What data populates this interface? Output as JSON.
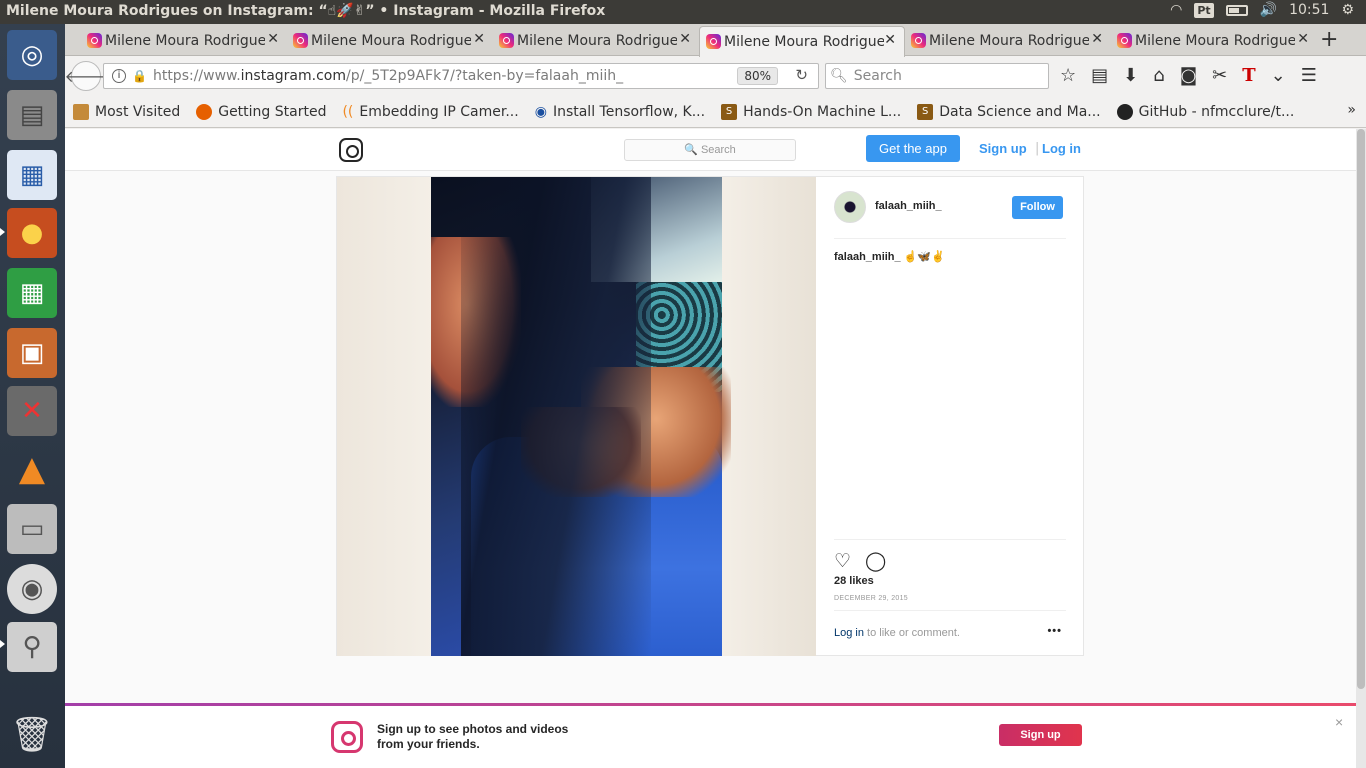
{
  "os": {
    "window_title": "Milene Moura Rodrigues on Instagram: “☝🚀✌” • Instagram - Mozilla Firefox",
    "keyboard_layout": "Pt",
    "clock": "10:51"
  },
  "browser": {
    "tabs": [
      {
        "label": "Milene Moura Rodrigues"
      },
      {
        "label": "Milene Moura Rodrigues"
      },
      {
        "label": "Milene Moura Rodrigues"
      },
      {
        "label": "Milene Moura Rodrigues"
      },
      {
        "label": "Milene Moura Rodrigues"
      },
      {
        "label": "Milene Moura Rodrigues"
      }
    ],
    "active_tab": 3,
    "url_host_prefix": "https://www.",
    "url_host": "instagram.com",
    "url_path": "/p/_5T2p9AFk7/?taken-by=falaah_miih_",
    "zoom": "80%",
    "search_placeholder": "Search",
    "bookmarks": [
      {
        "label": "Most Visited",
        "color": "#c48a3a"
      },
      {
        "label": "Getting Started",
        "color": "#e66000"
      },
      {
        "label": "Embedding IP Camer...",
        "color": "#f08a24"
      },
      {
        "label": "Install Tensorflow, K...",
        "color": "#1a4fa0"
      },
      {
        "label": "Hands-On Machine L...",
        "color": "#8a5a14"
      },
      {
        "label": "Data Science and Ma...",
        "color": "#8a5a14"
      },
      {
        "label": "GitHub - nfmcclure/t...",
        "color": "#222222"
      }
    ]
  },
  "instagram": {
    "search_placeholder": "🔍 Search",
    "get_app": "Get the app",
    "sign_up": "Sign up",
    "separator": "|",
    "log_in": "Log in",
    "post": {
      "username": "falaah_miih_",
      "follow": "Follow",
      "caption_user": "falaah_miih_",
      "caption_text": "☝🦋✌",
      "likes": "28 likes",
      "date": "DECEMBER 29, 2015",
      "comment_login": "Log in",
      "comment_text": " to like or comment.",
      "more": "•••"
    },
    "banner": {
      "text": "Sign up to see photos and videos from your friends.",
      "button": "Sign up",
      "close": "×"
    }
  },
  "colors": {
    "accent": "#3897f0",
    "signup_gradient_start": "#c92e66",
    "signup_gradient_end": "#e0344d"
  }
}
